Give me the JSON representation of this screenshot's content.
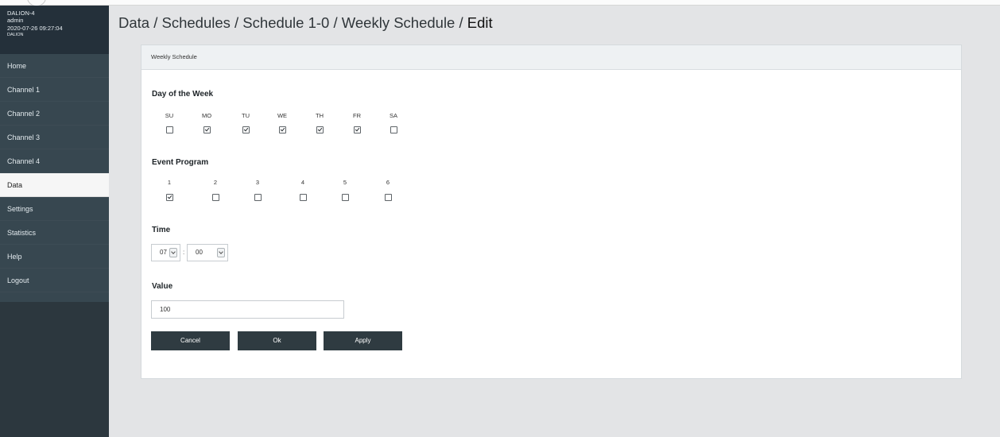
{
  "device": {
    "name": "DALION-4",
    "user": "admin",
    "datetime": "2020-07-26 09:27:04",
    "brand": "DALION"
  },
  "nav": [
    {
      "label": "Home",
      "active": false
    },
    {
      "label": "Channel 1",
      "active": false
    },
    {
      "label": "Channel 2",
      "active": false
    },
    {
      "label": "Channel 3",
      "active": false
    },
    {
      "label": "Channel 4",
      "active": false
    },
    {
      "label": "Data",
      "active": true
    },
    {
      "label": "Settings",
      "active": false
    },
    {
      "label": "Statistics",
      "active": false
    },
    {
      "label": "Help",
      "active": false
    },
    {
      "label": "Logout",
      "active": false
    }
  ],
  "breadcrumb": {
    "path": "Data / Schedules / Schedule 1-0 / Weekly Schedule / ",
    "current": "Edit"
  },
  "panel": {
    "title": "Weekly Schedule"
  },
  "days": {
    "title": "Day of the Week",
    "items": [
      {
        "label": "SU",
        "checked": false
      },
      {
        "label": "MO",
        "checked": true
      },
      {
        "label": "TU",
        "checked": true
      },
      {
        "label": "WE",
        "checked": true
      },
      {
        "label": "TH",
        "checked": true
      },
      {
        "label": "FR",
        "checked": true
      },
      {
        "label": "SA",
        "checked": false
      }
    ]
  },
  "programs": {
    "title": "Event Program",
    "items": [
      {
        "label": "1",
        "checked": true
      },
      {
        "label": "2",
        "checked": false
      },
      {
        "label": "3",
        "checked": false
      },
      {
        "label": "4",
        "checked": false
      },
      {
        "label": "5",
        "checked": false
      },
      {
        "label": "6",
        "checked": false
      }
    ]
  },
  "time": {
    "title": "Time",
    "hour": "07",
    "separator": ":",
    "minute": "00"
  },
  "value": {
    "title": "Value",
    "current": "100"
  },
  "buttons": {
    "cancel": "Cancel",
    "ok": "Ok",
    "apply": "Apply"
  }
}
